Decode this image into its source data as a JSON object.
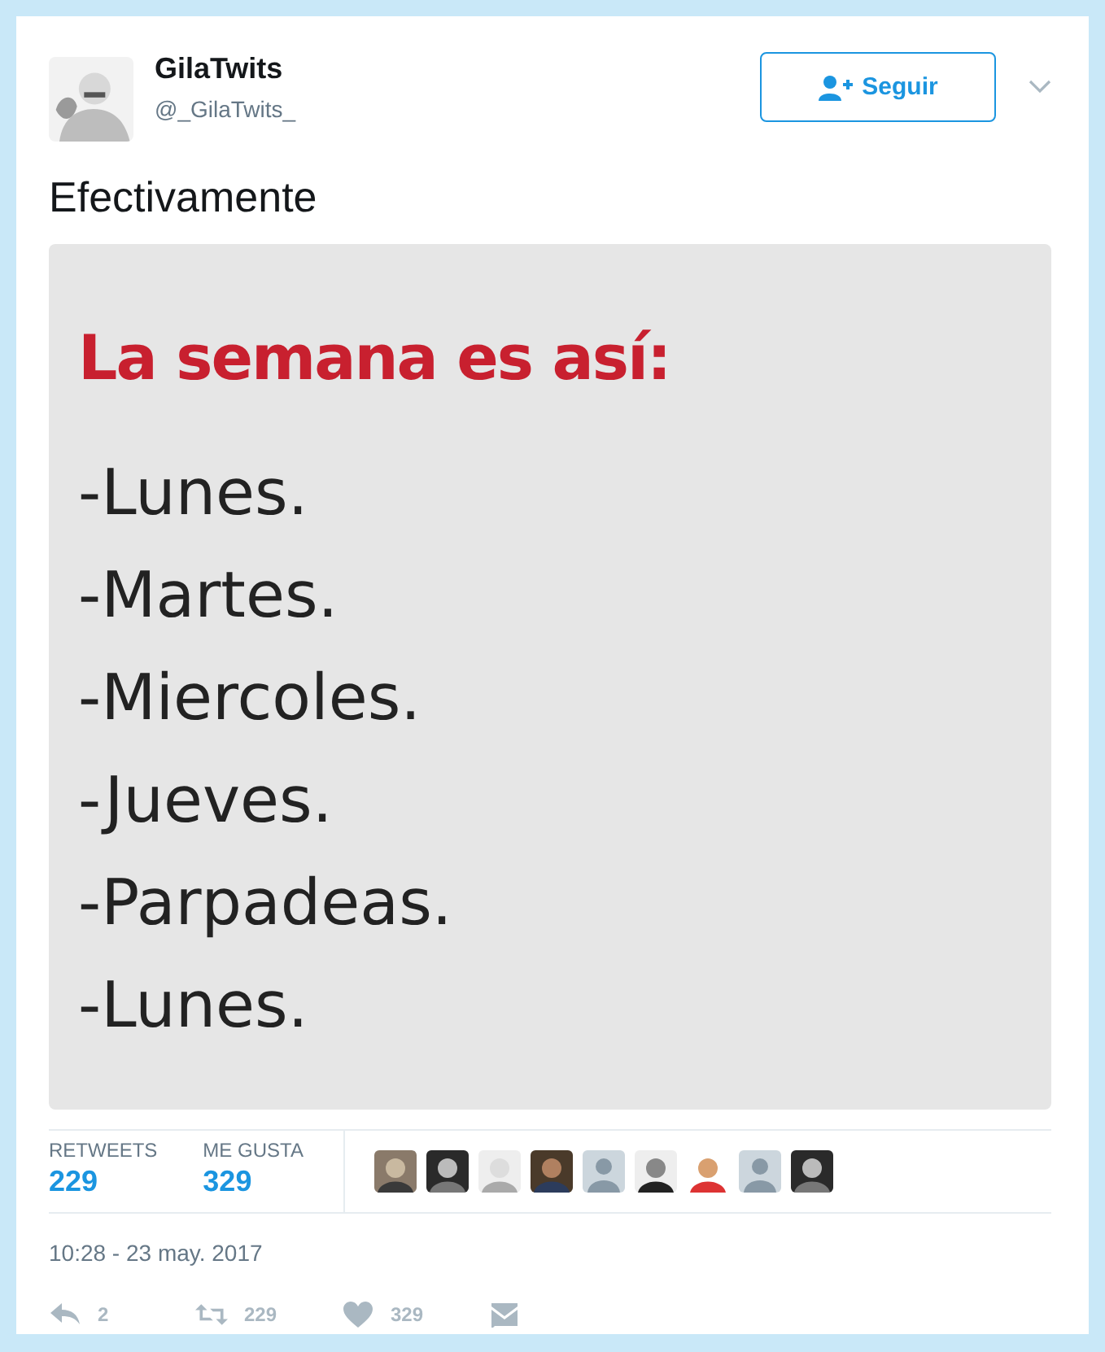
{
  "user": {
    "name": "GilaTwits",
    "handle": "@_GilaTwits_"
  },
  "follow_button": {
    "label": "Seguir"
  },
  "tweet_text": "Efectivamente",
  "image": {
    "heading": "La semana es así:",
    "lines": [
      "-Lunes.",
      "-Martes.",
      "-Miercoles.",
      "-Jueves.",
      "-Parpadeas.",
      "-Lunes."
    ]
  },
  "stats": [
    {
      "label": "RETWEETS",
      "value": "229"
    },
    {
      "label": "ME GUSTA",
      "value": "329"
    }
  ],
  "likers": [
    {
      "kind": "picture"
    },
    {
      "kind": "picture"
    },
    {
      "kind": "picture"
    },
    {
      "kind": "picture"
    },
    {
      "kind": "default"
    },
    {
      "kind": "picture"
    },
    {
      "kind": "picture"
    },
    {
      "kind": "default"
    },
    {
      "kind": "picture"
    }
  ],
  "timestamp": "10:28 - 23 may. 2017",
  "actions": [
    {
      "kind": "reply",
      "count": "2"
    },
    {
      "kind": "retweet",
      "count": "229"
    },
    {
      "kind": "like",
      "count": "329"
    },
    {
      "kind": "message"
    }
  ]
}
